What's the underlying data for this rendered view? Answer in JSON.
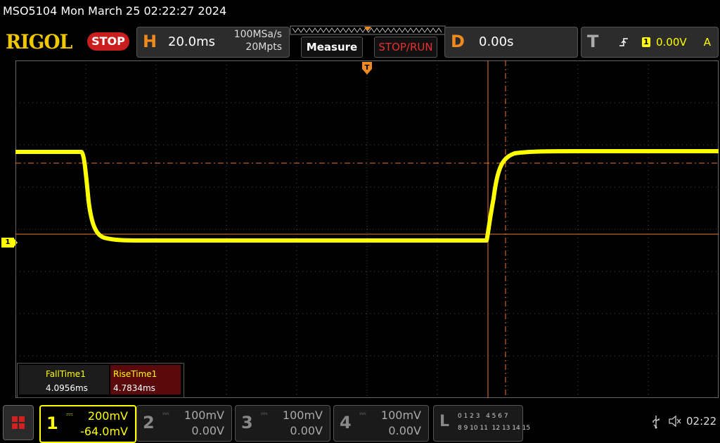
{
  "title_line": "MSO5104  Mon March 25 02:22:27 2024",
  "logo": "RIGOL",
  "run_state": "STOP",
  "horizontal": {
    "letter": "H",
    "timebase": "20.0ms",
    "sample_rate": "100MSa/s",
    "memory_depth": "20Mpts"
  },
  "buttons": {
    "measure": "Measure",
    "stop_run": "STOP/RUN"
  },
  "delay": {
    "letter": "D",
    "value": "0.00s"
  },
  "trigger": {
    "letter": "T",
    "source": "1",
    "level": "0.00V",
    "mode": "A"
  },
  "trigger_marker": "T",
  "channel_marker": "1",
  "measurements": [
    {
      "name": "FallTime1",
      "value": "4.0956ms"
    },
    {
      "name": "RiseTime1",
      "value": "4.7834ms"
    }
  ],
  "channels": [
    {
      "num": "1",
      "scale": "200mV",
      "offset": "-64.0mV",
      "active": true,
      "color": "#ffff00"
    },
    {
      "num": "2",
      "scale": "100mV",
      "offset": "0.00V",
      "active": false,
      "color": "#888888"
    },
    {
      "num": "3",
      "scale": "100mV",
      "offset": "0.00V",
      "active": false,
      "color": "#888888"
    },
    {
      "num": "4",
      "scale": "100mV",
      "offset": "0.00V",
      "active": false,
      "color": "#888888"
    }
  ],
  "logic": {
    "letter": "L",
    "row1": "0 1 2 3   4 5 6 7",
    "row2": "8 9 10 11  12 13 14 15"
  },
  "clock": "02:22",
  "colors": {
    "trace": "#ffff00",
    "accent": "#f08a1e",
    "cursor": "#e87830",
    "stop_red": "#c81e1e",
    "grid": "#4a4a4a"
  }
}
